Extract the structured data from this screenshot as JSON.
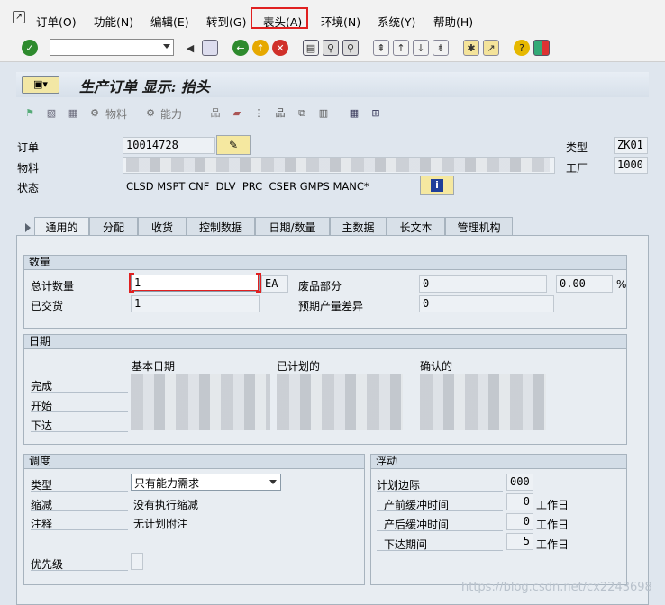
{
  "menu": {
    "items": [
      "订单(O)",
      "功能(N)",
      "编辑(E)",
      "转到(G)",
      "表头(A)",
      "环境(N)",
      "系统(Y)",
      "帮助(H)"
    ]
  },
  "toolbar": {
    "command_value": ""
  },
  "title": "生产订单 显示: 抬头",
  "app_toolbar": {
    "material_label": "物料",
    "capacity_label": "能力"
  },
  "header": {
    "order_label": "订单",
    "order_value": "10014728",
    "material_label": "物料",
    "status_label": "状态",
    "status_value": "CLSD MSPT CNF  DLV  PRC  CSER GMPS MANC*",
    "type_label": "类型",
    "type_value": "ZK01",
    "plant_label": "工厂",
    "plant_value": "1000"
  },
  "tabs": [
    "通用的",
    "分配",
    "收货",
    "控制数据",
    "日期/数量",
    "主数据",
    "长文本",
    "管理机构"
  ],
  "quantity": {
    "title": "数量",
    "total_label": "总计数量",
    "total_value": "1",
    "unit": "EA",
    "scrap_label": "废品部分",
    "scrap_value": "0",
    "scrap_pct": "0.00",
    "pct_sign": "%",
    "delivered_label": "已交货",
    "delivered_value": "1",
    "expected_label": "预期产量差异",
    "expected_value": "0"
  },
  "dates": {
    "title": "日期",
    "col_basic": "基本日期",
    "col_scheduled": "已计划的",
    "col_confirmed": "确认的",
    "finish_label": "完成",
    "start_label": "开始",
    "release_label": "下达"
  },
  "scheduling": {
    "title": "调度",
    "type_label": "类型",
    "type_value": "只有能力需求",
    "reduction_label": "缩减",
    "reduction_value": "没有执行缩减",
    "note_label": "注释",
    "note_value": "无计划附注",
    "priority_label": "优先级"
  },
  "floats": {
    "title": "浮动",
    "margin_label": "计划边际",
    "margin_value": "000",
    "before_label": "产前缓冲时间",
    "before_value": "0",
    "after_label": "产后缓冲时间",
    "after_value": "0",
    "release_label": "下达期间",
    "release_value": "5",
    "unit": "工作日"
  },
  "watermark": "https://blog.csdn.net/cx2243698",
  "colors": {
    "highlight": "#e02020",
    "panel": "#e8edf2",
    "header": "#d3dde7"
  }
}
